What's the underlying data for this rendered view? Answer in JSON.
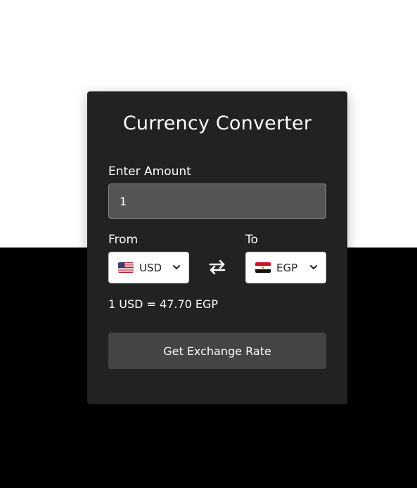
{
  "app": {
    "title": "Currency Converter"
  },
  "amount": {
    "label": "Enter Amount",
    "value": "1"
  },
  "from": {
    "label": "From",
    "currency": "USD",
    "flag_icon": "us-flag-icon"
  },
  "to": {
    "label": "To",
    "currency": "EGP",
    "flag_icon": "egypt-flag-icon"
  },
  "swap_icon": "swap-arrows-icon",
  "result": {
    "text": "1 USD = 47.70 EGP"
  },
  "button": {
    "label": "Get Exchange Rate"
  },
  "colors": {
    "card_background": "#222222",
    "input_background": "#555555",
    "button_background": "#444444",
    "page_top": "#ffffff",
    "page_bottom": "#000000"
  }
}
